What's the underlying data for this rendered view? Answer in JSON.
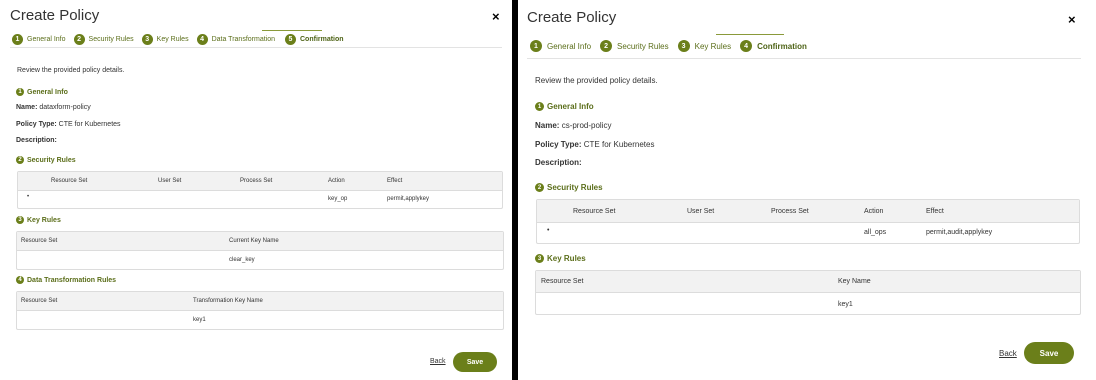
{
  "left": {
    "title": "Create Policy",
    "close": "×",
    "steps": [
      {
        "n": "1",
        "label": "General Info"
      },
      {
        "n": "2",
        "label": "Security Rules"
      },
      {
        "n": "3",
        "label": "Key Rules"
      },
      {
        "n": "4",
        "label": "Data Transformation"
      },
      {
        "n": "5",
        "label": "Confirmation"
      }
    ],
    "intro": "Review the provided policy details.",
    "general": {
      "n": "1",
      "heading": "General Info",
      "name_label": "Name:",
      "name_value": "dataxform-policy",
      "type_label": "Policy Type:",
      "type_value": "CTE for Kubernetes",
      "desc_label": "Description:"
    },
    "security": {
      "n": "2",
      "heading": "Security Rules",
      "columns": [
        "Resource Set",
        "User Set",
        "Process Set",
        "Action",
        "Effect"
      ],
      "row": [
        "•",
        "",
        "",
        "key_op",
        "permit,applykey"
      ]
    },
    "key_rules": {
      "n": "3",
      "heading": "Key Rules",
      "columns": [
        "Resource Set",
        "Current Key Name"
      ],
      "row": [
        "",
        "clear_key"
      ]
    },
    "data_rules": {
      "n": "4",
      "heading": "Data Transformation Rules",
      "columns": [
        "Resource Set",
        "Transformation Key Name"
      ],
      "row": [
        "",
        "key1"
      ]
    },
    "back": "Back",
    "save": "Save"
  },
  "right": {
    "title": "Create Policy",
    "close": "×",
    "steps": [
      {
        "n": "1",
        "label": "General Info"
      },
      {
        "n": "2",
        "label": "Security Rules"
      },
      {
        "n": "3",
        "label": "Key Rules"
      },
      {
        "n": "4",
        "label": "Confirmation"
      }
    ],
    "intro": "Review the provided policy details.",
    "general": {
      "n": "1",
      "heading": "General Info",
      "name_label": "Name:",
      "name_value": "cs-prod-policy",
      "type_label": "Policy Type:",
      "type_value": "CTE for Kubernetes",
      "desc_label": "Description:"
    },
    "security": {
      "n": "2",
      "heading": "Security Rules",
      "columns": [
        "Resource Set",
        "User Set",
        "Process Set",
        "Action",
        "Effect"
      ],
      "row": [
        "•",
        "",
        "",
        "all_ops",
        "permit,audit,applykey"
      ]
    },
    "key_rules": {
      "n": "3",
      "heading": "Key Rules",
      "columns": [
        "Resource Set",
        "Key Name"
      ],
      "row": [
        "",
        "key1"
      ]
    },
    "back": "Back",
    "save": "Save"
  }
}
